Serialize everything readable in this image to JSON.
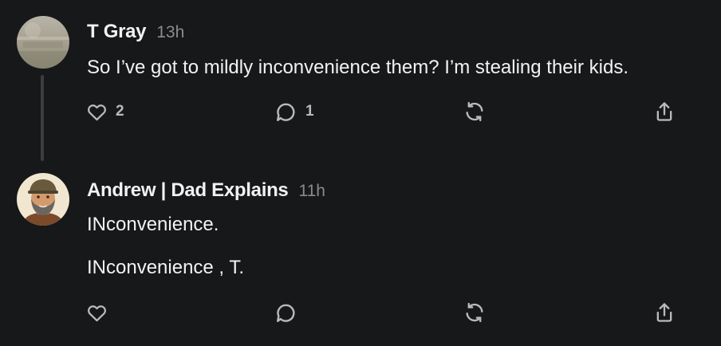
{
  "comments": [
    {
      "author": "T Gray",
      "time": "13h",
      "lines": [
        "So I’ve got to mildly inconvenience them? I’m stealing their kids."
      ],
      "actions": {
        "likes": "2",
        "replies": "1"
      }
    },
    {
      "author": "Andrew | Dad Explains",
      "time": "11h",
      "lines": [
        "INconvenience.",
        "INconvenience , T."
      ],
      "actions": {
        "likes": "",
        "replies": ""
      }
    }
  ],
  "icons": {
    "like": "heart-icon",
    "reply": "speech-bubble-icon",
    "restack": "restack-arrows-icon",
    "share": "share-icon"
  },
  "colors": {
    "background": "#17181a",
    "text": "#f2f2f3",
    "muted": "#8a8b8f",
    "icon": "#b9babd"
  }
}
